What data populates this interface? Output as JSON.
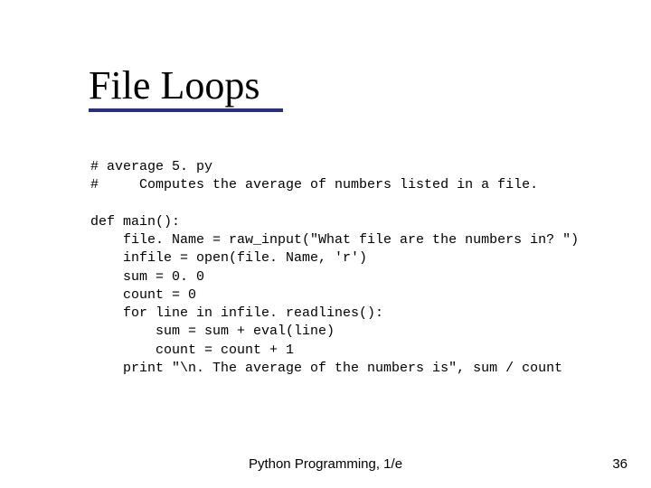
{
  "title": "File Loops",
  "code_lines": [
    "# average 5. py",
    "#     Computes the average of numbers listed in a file.",
    "",
    "def main():",
    "    file. Name = raw_input(\"What file are the numbers in? \")",
    "    infile = open(file. Name, 'r')",
    "    sum = 0. 0",
    "    count = 0",
    "    for line in infile. readlines():",
    "        sum = sum + eval(line)",
    "        count = count + 1",
    "    print \"\\n. The average of the numbers is\", sum / count"
  ],
  "footer_center": "Python Programming, 1/e",
  "footer_right": "36"
}
